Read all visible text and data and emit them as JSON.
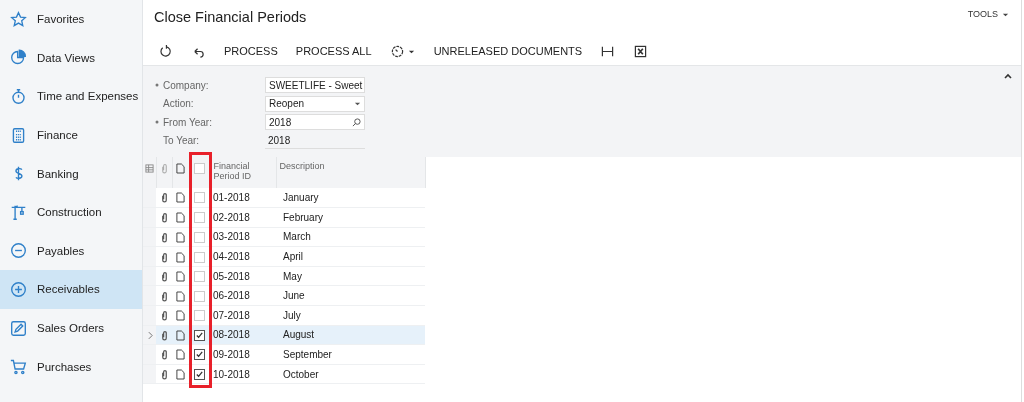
{
  "sidebar": {
    "items": [
      {
        "label": "Favorites",
        "selected": false
      },
      {
        "label": "Data Views",
        "selected": false
      },
      {
        "label": "Time and Expenses",
        "selected": false
      },
      {
        "label": "Finance",
        "selected": false
      },
      {
        "label": "Banking",
        "selected": false
      },
      {
        "label": "Construction",
        "selected": false
      },
      {
        "label": "Payables",
        "selected": false
      },
      {
        "label": "Receivables",
        "selected": true
      },
      {
        "label": "Sales Orders",
        "selected": false
      },
      {
        "label": "Purchases",
        "selected": false
      }
    ]
  },
  "page": {
    "title": "Close Financial Periods",
    "tools": "TOOLS"
  },
  "toolbar": [
    {
      "kind": "icon"
    },
    {
      "kind": "icon"
    },
    {
      "kind": "text",
      "label": "PROCESS"
    },
    {
      "kind": "text",
      "label": "PROCESS ALL"
    },
    {
      "kind": "menu"
    },
    {
      "kind": "text",
      "label": "UNRELEASED DOCUMENTS"
    },
    {
      "kind": "icon"
    },
    {
      "kind": "icon"
    }
  ],
  "form": {
    "fields": [
      {
        "label": "Company:",
        "required": true,
        "value": "SWEETLIFE - Sweet",
        "kind": "lookup"
      },
      {
        "label": "Action:",
        "required": false,
        "value": "Reopen",
        "kind": "select"
      },
      {
        "label": "From Year:",
        "required": true,
        "value": "2018",
        "kind": "lookup"
      },
      {
        "label": "To Year:",
        "required": false,
        "value": "2018",
        "kind": "readonly"
      }
    ]
  },
  "table": {
    "highlighted_column": true,
    "header_checked": false,
    "columns": [
      "Financial Period ID",
      "Description"
    ],
    "rows": [
      {
        "period": "01-2018",
        "description": "January",
        "checked": false,
        "selected": false
      },
      {
        "period": "02-2018",
        "description": "February",
        "checked": false,
        "selected": false
      },
      {
        "period": "03-2018",
        "description": "March",
        "checked": false,
        "selected": false
      },
      {
        "period": "04-2018",
        "description": "April",
        "checked": false,
        "selected": false
      },
      {
        "period": "05-2018",
        "description": "May",
        "checked": false,
        "selected": false
      },
      {
        "period": "06-2018",
        "description": "June",
        "checked": false,
        "selected": false
      },
      {
        "period": "07-2018",
        "description": "July",
        "checked": false,
        "selected": false
      },
      {
        "period": "08-2018",
        "description": "August",
        "checked": true,
        "selected": true
      },
      {
        "period": "09-2018",
        "description": "September",
        "checked": true,
        "selected": false
      },
      {
        "period": "10-2018",
        "description": "October",
        "checked": true,
        "selected": false
      }
    ]
  }
}
